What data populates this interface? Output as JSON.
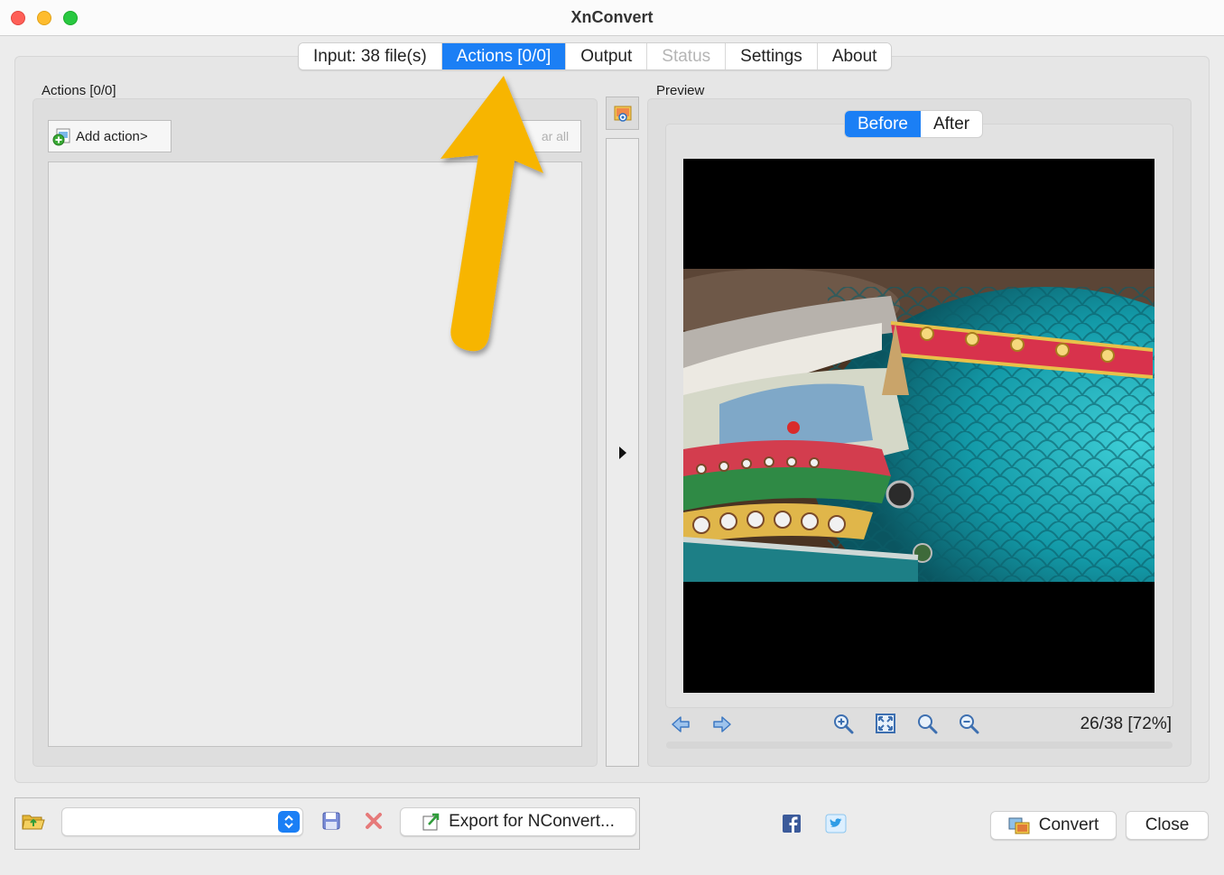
{
  "window": {
    "title": "XnConvert"
  },
  "tabs": [
    {
      "label": "Input: 38 file(s)",
      "state": "normal"
    },
    {
      "label": "Actions [0/0]",
      "state": "active"
    },
    {
      "label": "Output",
      "state": "normal"
    },
    {
      "label": "Status",
      "state": "disabled"
    },
    {
      "label": "Settings",
      "state": "normal"
    },
    {
      "label": "About",
      "state": "normal"
    }
  ],
  "actions": {
    "label": "Actions [0/0]",
    "add_button": "Add action>",
    "clear_all": "ar all"
  },
  "preview": {
    "label": "Preview",
    "toggle_before": "Before",
    "toggle_after": "After",
    "counter": "26/38 [72%]"
  },
  "bottom": {
    "export_button": "Export for NConvert...",
    "convert_button": "Convert",
    "close_button": "Close"
  },
  "colors": {
    "accent": "#1b7ff5",
    "annotation_arrow": "#f7b500"
  },
  "icons": [
    "folder-open-icon",
    "save-icon",
    "delete-icon",
    "export-icon",
    "facebook-icon",
    "twitter-icon",
    "convert-icon",
    "prev-icon",
    "next-icon",
    "zoom-in-icon",
    "fit-icon",
    "zoom-actual-icon",
    "zoom-out-icon",
    "preview-image-icon",
    "expand-right-icon",
    "add-action-icon"
  ]
}
